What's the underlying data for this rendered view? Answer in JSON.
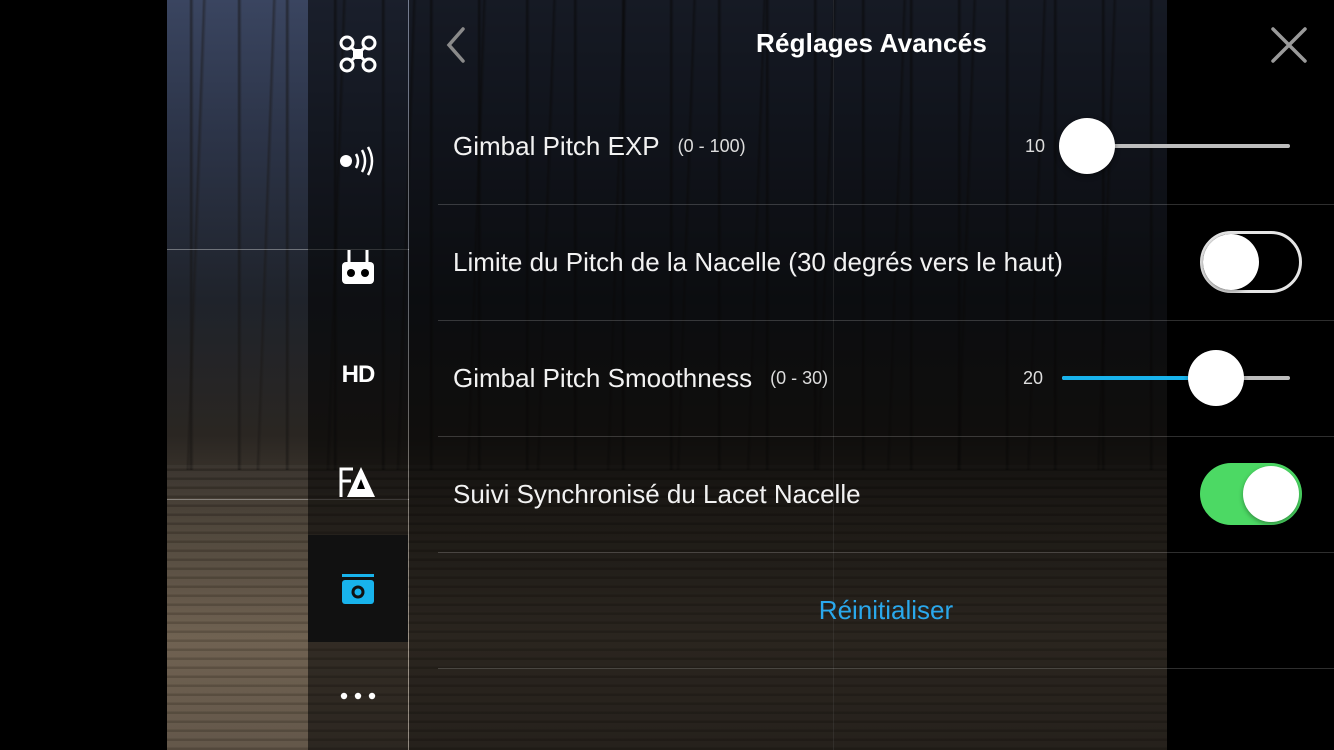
{
  "header": {
    "title": "Réglages Avancés",
    "back_icon": "chevron-left-icon",
    "close_icon": "close-icon"
  },
  "sidebar": {
    "items": [
      {
        "name": "aircraft",
        "icon": "drone-icon",
        "active": false
      },
      {
        "name": "signal",
        "icon": "signal-icon",
        "active": false
      },
      {
        "name": "remote",
        "icon": "remote-controller-icon",
        "active": false
      },
      {
        "name": "hd",
        "label": "HD",
        "active": false
      },
      {
        "name": "flight-battery",
        "icon": "battery-settings-icon",
        "active": false
      },
      {
        "name": "gimbal",
        "icon": "camera-gimbal-icon",
        "active": true
      },
      {
        "name": "more",
        "icon": "more-icon",
        "active": false
      }
    ],
    "active_color": "#18b3ec"
  },
  "settings": {
    "gimbal_pitch_exp": {
      "label": "Gimbal Pitch EXP",
      "range": "(0 - 100)",
      "value": "10",
      "min": 0,
      "max": 100,
      "current": 10
    },
    "pitch_limit": {
      "label": "Limite du Pitch de la Nacelle (30 degrés vers le haut)",
      "enabled": false
    },
    "gimbal_pitch_smoothness": {
      "label": "Gimbal Pitch Smoothness",
      "range": "(0 - 30)",
      "value": "20",
      "min": 0,
      "max": 30,
      "current": 20
    },
    "yaw_sync": {
      "label": "Suivi Synchronisé du Lacet Nacelle",
      "enabled": true
    },
    "reset_label": "Réinitialiser"
  },
  "colors": {
    "accent": "#18b3ec",
    "toggle_on": "#4cd964",
    "reset": "#2aa8ec"
  }
}
